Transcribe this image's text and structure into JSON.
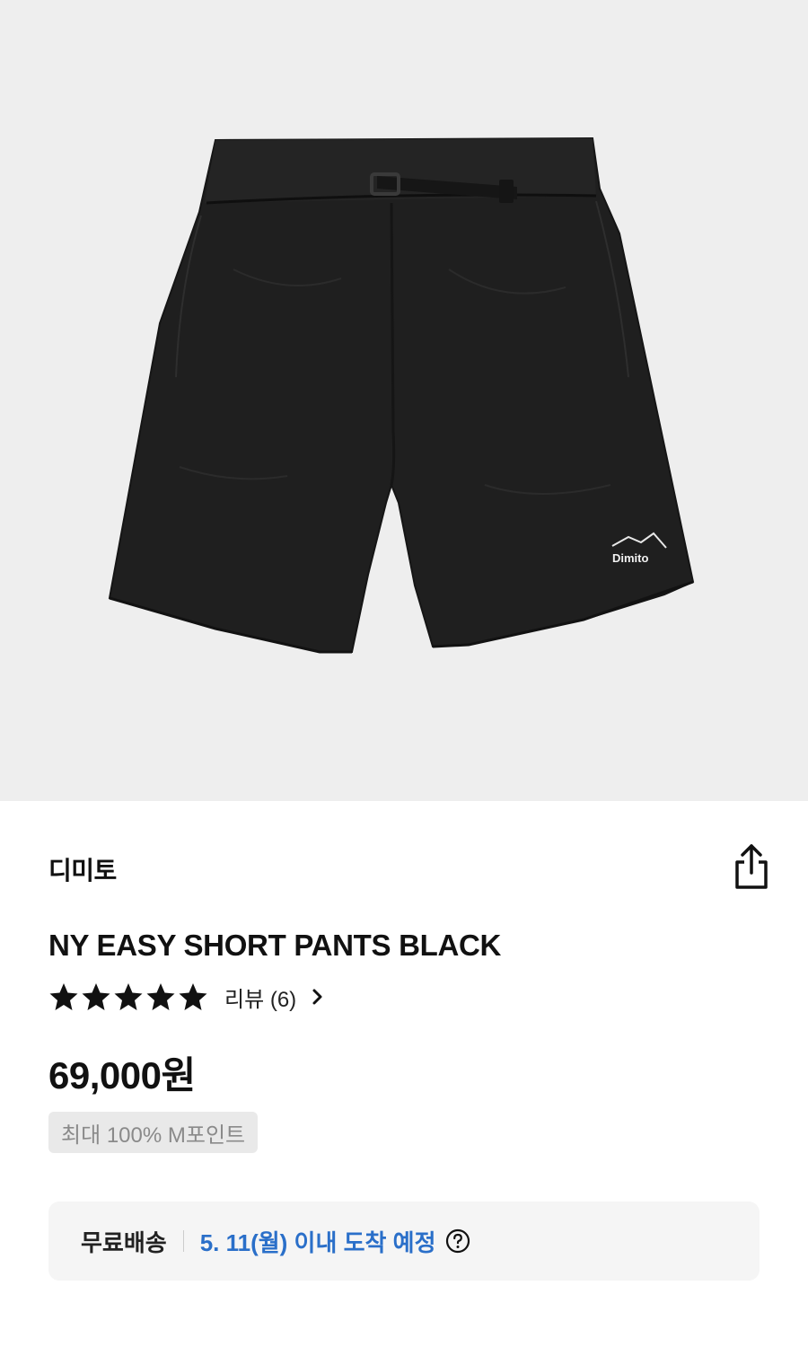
{
  "product": {
    "brand": "디미토",
    "name": "NY EASY SHORT PANTS BLACK",
    "image_logo_text": "Dimito",
    "rating": 5,
    "rating_max": 5,
    "review_label": "리뷰 (6)",
    "price": "69,000원",
    "points_badge": "최대 100% M포인트"
  },
  "shipping": {
    "label": "무료배송",
    "eta": "5. 11(월) 이내 도착 예정"
  },
  "icons": {
    "share": "share-icon",
    "star": "star-icon",
    "chevron": "chevron-right-icon",
    "help": "help-circle-icon"
  },
  "colors": {
    "hero_background": "#eeeeee",
    "shorts": "#1f1f1f",
    "eta_text": "#2a6fc9",
    "badge_background": "#e9e9e9"
  }
}
